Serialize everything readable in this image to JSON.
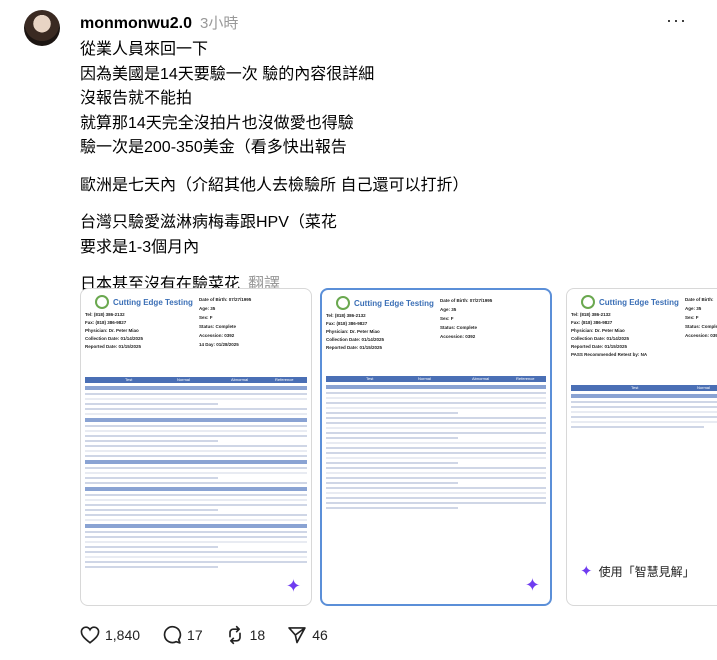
{
  "post": {
    "username": "monmonwu2.0",
    "time": "3小時",
    "more": "···",
    "paragraphs": [
      [
        "從業人員來回一下",
        "因為美國是14天要驗一次 驗的內容很詳細",
        "沒報告就不能拍",
        "就算那14天完全沒拍片也沒做愛也得驗",
        "驗一次是200-350美金（看多快出報告"
      ],
      [
        "歐洲是七天內（介紹其他人去檢驗所 自己還可以打折）"
      ],
      [
        "台灣只驗愛滋淋病梅毒跟HPV（菜花",
        "要求是1-3個月內"
      ],
      [
        "日本甚至沒有在驗菜花"
      ]
    ],
    "translate": "翻譯"
  },
  "images": [
    {
      "logo": "Cutting Edge Testing",
      "right_fields": [
        "Date of Birth: 07/27/1995",
        "Age: 35",
        "Sex: F",
        "Status: Complete",
        "Accession: 0392",
        "14 Day: 01/28/2025"
      ],
      "left_fields": [
        "Tel: (818) 386-2132",
        "Fax: (818) 386-9827",
        "Physician: Dr. Peter Miao",
        "Collection Date: 01/14/2025",
        "Reported Date: 01/15/2025"
      ],
      "table_headers": [
        "Test",
        "Normal",
        "Abnormal",
        "Reference"
      ]
    },
    {
      "logo": "Cutting Edge Testing",
      "right_fields": [
        "Date of Birth: 07/27/1995",
        "Age: 35",
        "Sex: F",
        "Status: Complete",
        "Accession: 0392"
      ],
      "left_fields": [
        "Tel: (818) 386-2132",
        "Fax: (818) 386-9827",
        "Physician: Dr. Peter Miao",
        "Collection Date: 01/14/2025",
        "Reported Date: 01/15/2025"
      ],
      "table_headers": [
        "Test",
        "Normal",
        "Abnormal",
        "Reference"
      ]
    },
    {
      "logo": "Cutting Edge Testing",
      "right_fields": [
        "Date of Birth:",
        "Age: 35",
        "Sex: F",
        "Status: Complet",
        "Accession: 039"
      ],
      "left_fields": [
        "Tel: (818) 386-2132",
        "Fax: (818) 386-9827",
        "Physician: Dr. Peter Miao",
        "Collection Date: 01/14/2025",
        "Reported Date: 01/15/2025",
        "PASS Recommended Retest by: NA"
      ],
      "table_headers": [
        "Test",
        "Normal"
      ]
    }
  ],
  "insight_label": "使用「智慧見解」",
  "actions": {
    "likes": "1,840",
    "comments": "17",
    "reposts": "18",
    "shares": "46"
  }
}
